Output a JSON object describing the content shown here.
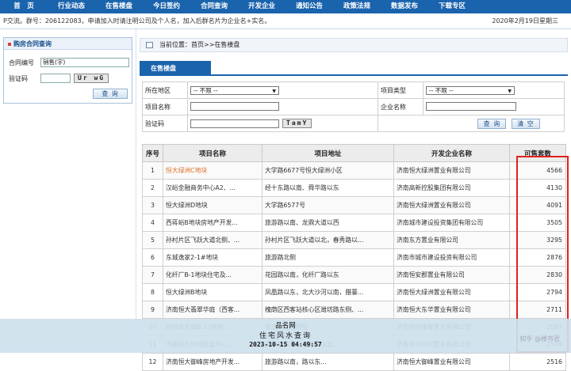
{
  "nav": [
    "首　页",
    "行业动态",
    "在售楼盘",
    "今日签约",
    "合同查询",
    "开发企业",
    "通知公告",
    "政策法规",
    "数据发布",
    "下载专区"
  ],
  "notice": {
    "text": "P交流。群号：206122083，申请加入时请注明公司及个人名，加入后群名片为企业名+实名。",
    "date": "2020年2月19日星期三"
  },
  "sidebar": {
    "title": "购房合同查询",
    "contract_label": "合同编号",
    "contract_value": "销售(字)",
    "captcha_label": "验证码",
    "captcha_text": "Ur wG",
    "query_btn": "查 询"
  },
  "breadcrumb": "当前位置：首页>>在售楼盘",
  "tab": "在售楼盘",
  "filter": {
    "district_label": "所在地区",
    "district_value": "-- 不限 --",
    "type_label": "项目类型",
    "type_value": "-- 不限 --",
    "name_label": "项目名称",
    "company_label": "企业名称",
    "captcha_label": "验证码",
    "captcha_text": "TamY",
    "query_btn": "查 询",
    "clear_btn": "清 空"
  },
  "table": {
    "headers": [
      "序号",
      "项目名称",
      "项目地址",
      "开发企业名称",
      "可售套数"
    ],
    "rows": [
      {
        "no": "1",
        "name": "恒大绿洲C地块",
        "addr": "大学路6677号恒大绿洲小区",
        "company": "济南恒大绿洲置业有限公司",
        "count": "4566"
      },
      {
        "no": "2",
        "name": "汉峪金融商务中心A2、...",
        "addr": "经十东路以南、舜华路以东",
        "company": "济南高新控股集团有限公司",
        "count": "4130"
      },
      {
        "no": "3",
        "name": "恒大绿洲D地块",
        "addr": "大学路6577号",
        "company": "济南恒大绿洲置业有限公司",
        "count": "4091"
      },
      {
        "no": "4",
        "name": "西蒋峪B地块房地产开发...",
        "addr": "旅游路以南、龙鼎大道以西",
        "company": "济南城市建设投资集团有限公司",
        "count": "3505"
      },
      {
        "no": "5",
        "name": "孙村片区飞跃大道北侧、...",
        "addr": "孙村片区飞跃大道以北，春秀路以...",
        "company": "济南东方置业有限公司",
        "count": "3295"
      },
      {
        "no": "6",
        "name": "东城逸家2-1#地块",
        "addr": "旅游路北侧",
        "company": "济南市城市建设投资有限公司",
        "count": "2876"
      },
      {
        "no": "7",
        "name": "化纤厂B-1地块住宅及...",
        "addr": "花园路以南，化纤厂路以东",
        "company": "济南恒安郡置业有限公司",
        "count": "2830"
      },
      {
        "no": "8",
        "name": "恒大绿洲B地块",
        "addr": "凤凰路以东，北大沙河以南，腊薹...",
        "company": "济南恒大绿洲置业有限公司",
        "count": "2794"
      },
      {
        "no": "9",
        "name": "济南恒大翡翠华庭（西客...",
        "addr": "槐荫区西客站核心区潍坊路东侧、...",
        "company": "济南恒大东华置业有限公司",
        "count": "2711"
      },
      {
        "no": "10",
        "name": "绿地高北康B-12地块...",
        "addr": "省道103线西侧",
        "company": "济南绿地康鲁置业有限公司",
        "count": "2587"
      },
      {
        "no": "11",
        "name": "济南恒大时代财富中心...",
        "addr": "大学路以北，旅游路以北...",
        "company": "济南恒大时代置业有限公司",
        "count": "2548"
      },
      {
        "no": "12",
        "name": "济南恒大御峰房地产开发...",
        "addr": "旅游路以南，路以东...",
        "company": "济南恒大御峰置业有限公司",
        "count": "2516"
      }
    ]
  },
  "watermark": {
    "line1": "品名网",
    "line2": "住宅风水查询",
    "line3": "2023-10-15 04:49:57",
    "corner": "知乎 @楼市君"
  }
}
